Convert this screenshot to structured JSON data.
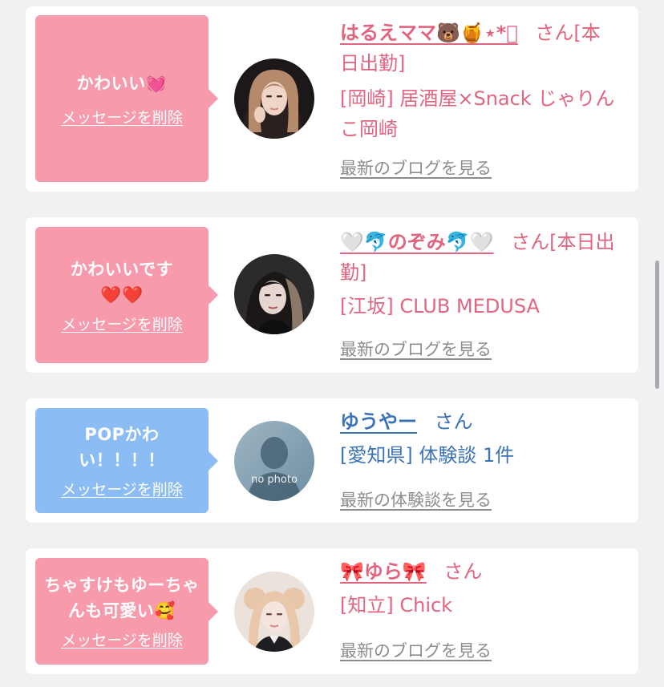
{
  "cards": [
    {
      "bubble_text": "かわいい💓",
      "delete_label": "メッセージを削除",
      "name": "はるえママ🐻🍯⋆*ﾟ",
      "suffix": "さん[本日出勤]",
      "shop": "[岡崎] 居酒屋×Snack じゃりんこ岡崎",
      "link": "最新のブログを見る"
    },
    {
      "bubble_text": "かわいいです❤️❤️",
      "delete_label": "メッセージを削除",
      "name": "🤍🐬のぞみ🐬🤍",
      "suffix": "さん[本日出勤]",
      "shop": "[江坂] CLUB MEDUSA",
      "link": "最新のブログを見る"
    },
    {
      "bubble_text": "POPかわい！！！！",
      "delete_label": "メッセージを削除",
      "name": "ゆうやー",
      "suffix": "さん",
      "shop": "[愛知県] 体験談 1件",
      "link": "最新の体験談を見る",
      "avatar_text": "no photo"
    },
    {
      "bubble_text": "ちゃすけもゆーちゃんも可愛い🥰",
      "delete_label": "メッセージを削除",
      "name": "🎀ゆら🎀",
      "suffix": "さん",
      "shop": "[知立] Chick",
      "link": "最新のブログを見る"
    }
  ],
  "colors": {
    "pink_bubble": "#f79aac",
    "blue_bubble": "#8bbcf3",
    "pink_text": "#e26580",
    "blue_text": "#3b73b6",
    "link_gray": "#8d8d8d",
    "background": "#f1f1f3"
  }
}
